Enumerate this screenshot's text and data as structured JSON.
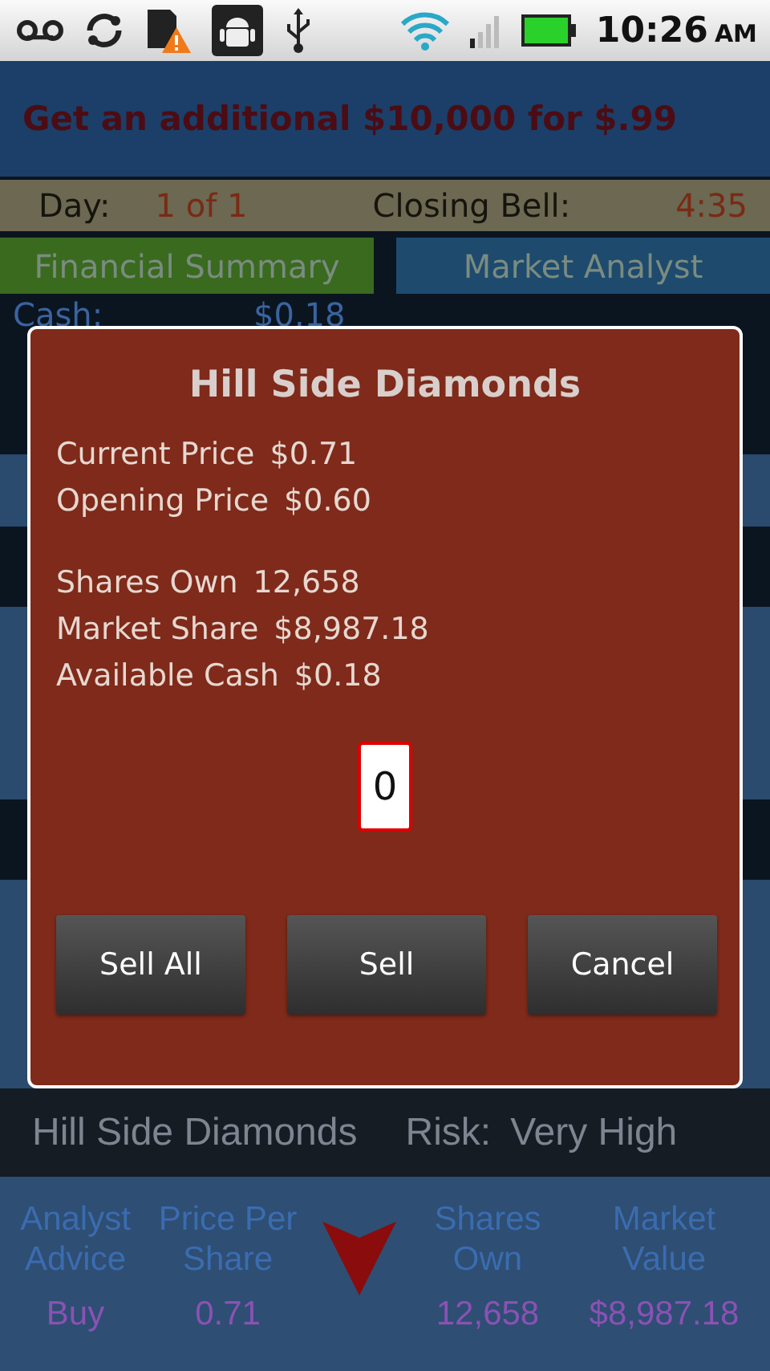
{
  "status_bar": {
    "time": "10:26",
    "ampm": "AM"
  },
  "promo": "Get an additional $10,000 for $.99",
  "day_bar": {
    "day_label": "Day:",
    "day": "1 of 1",
    "closing_label": "Closing Bell:",
    "closing": "4:35"
  },
  "tabs": [
    {
      "label": "Financial Summary",
      "color": "#3a6a1e"
    },
    {
      "label": "Market Analyst",
      "color": "#1e4a6e"
    }
  ],
  "summary": [
    {
      "label": "Cash:",
      "value": "$0.18"
    }
  ],
  "dialog": {
    "title": "Hill Side Diamonds",
    "price_lines": [
      {
        "label": "Current Price",
        "value": "$0.71"
      },
      {
        "label": "Opening Price",
        "value": "$0.60"
      }
    ],
    "holding_lines": [
      {
        "label": "Shares Own",
        "value": "12,658"
      },
      {
        "label": "Market Share",
        "value": "$8,987.18"
      },
      {
        "label": "Available Cash",
        "value": "$0.18"
      }
    ],
    "quantity": "0",
    "buttons": [
      "Sell All",
      "Sell",
      "Cancel"
    ]
  },
  "stock": {
    "name": "Hill Side Diamonds",
    "risk_label": "Risk:",
    "risk": "Very High",
    "columns": [
      "Analyst Advice",
      "Price Per Share",
      "Shares Own",
      "Market Value"
    ],
    "row": {
      "advice": "Buy",
      "price": "0.71",
      "shares": "12,658",
      "value": "$8,987.18"
    }
  }
}
